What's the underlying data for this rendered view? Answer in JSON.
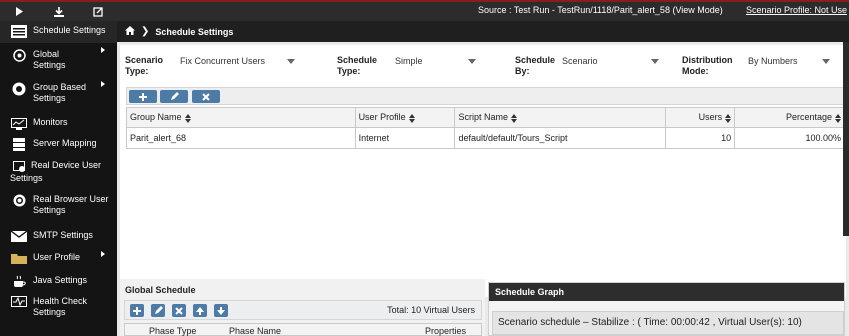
{
  "topbar": {
    "source_text": "Source : Test Run - TestRun/1118/Parit_alert_58 (View Mode)",
    "scenario_profile_link": "Scenario Profile: Not Use",
    "icons": [
      "play-icon",
      "download-icon",
      "export-icon"
    ]
  },
  "sidebar": {
    "items": [
      {
        "label": "Schedule Settings",
        "icon": "schedule-icon"
      },
      {
        "label": "Global Settings",
        "icon": "globe-icon",
        "submenu": true
      },
      {
        "label": "Group Based Settings",
        "icon": "group-icon",
        "submenu": true
      },
      {
        "label": "Monitors",
        "icon": "monitor-icon"
      },
      {
        "label": "Server Mapping",
        "icon": "server-icon"
      },
      {
        "label": "Real Device User Settings",
        "icon": "device-icon"
      },
      {
        "label": "Real Browser User Settings",
        "icon": "browser-icon"
      },
      {
        "label": "SMTP Settings",
        "icon": "mail-icon"
      },
      {
        "label": "User Profile",
        "icon": "folder-icon",
        "submenu": true
      },
      {
        "label": "Java Settings",
        "icon": "java-icon"
      },
      {
        "label": "Health Check Settings",
        "icon": "health-icon"
      }
    ]
  },
  "breadcrumb": {
    "home_icon": "home-icon",
    "current": "Schedule Settings"
  },
  "settings": {
    "scenario_type_label": "Scenario Type:",
    "scenario_type_value": "Fix Concurrent Users",
    "schedule_type_label": "Schedule Type:",
    "schedule_type_value": "Simple",
    "schedule_by_label": "Schedule By:",
    "schedule_by_value": "Scenario",
    "distribution_mode_label": "Distribution Mode:",
    "distribution_mode_value": "By Numbers"
  },
  "group_table": {
    "columns": [
      "Group Name",
      "User Profile",
      "Script Name",
      "Users",
      "Percentage"
    ],
    "rows": [
      {
        "group_name": "Parit_alert_68",
        "user_profile": "Internet",
        "script_name": "default/default/Tours_Script",
        "users": "10",
        "percentage": "100.00%"
      }
    ]
  },
  "global_schedule": {
    "title": "Global Schedule",
    "total": "Total: 10 Virtual Users",
    "columns": [
      "Phase Type",
      "Phase Name",
      "Properties"
    ]
  },
  "schedule_graph": {
    "title": "Schedule Graph",
    "status": "Scenario schedule – Stabilize : ( Time: 00:00:42 , Virtual User(s): 10)"
  },
  "colors": {
    "accent_button": "#4e7aa6",
    "topbar_bg": "#2c2c2c",
    "sidebar_bg": "#141414"
  }
}
